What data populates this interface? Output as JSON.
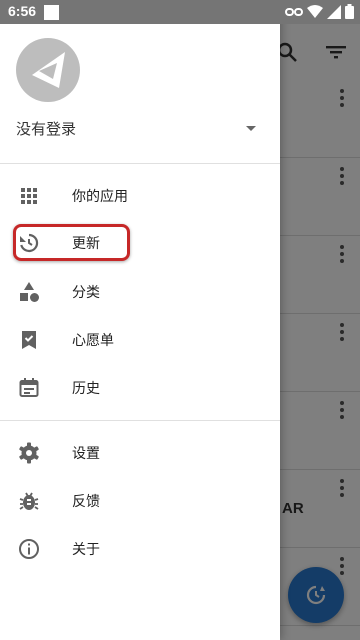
{
  "status_bar": {
    "time": "6:56"
  },
  "account": {
    "name": "没有登录"
  },
  "menu": {
    "items": [
      {
        "label": "你的应用",
        "icon": "apps-grid-icon"
      },
      {
        "label": "更新",
        "icon": "update-icon"
      },
      {
        "label": "分类",
        "icon": "category-icon"
      },
      {
        "label": "心愿单",
        "icon": "wishlist-icon"
      },
      {
        "label": "历史",
        "icon": "history-icon"
      }
    ],
    "secondary_items": [
      {
        "label": "设置",
        "icon": "settings-gear-icon"
      },
      {
        "label": "反馈",
        "icon": "feedback-bug-icon"
      },
      {
        "label": "关于",
        "icon": "about-info-icon"
      }
    ]
  },
  "background": {
    "visible_text": "AR"
  },
  "colors": {
    "highlight": "#c62828",
    "fab": "#2979cf",
    "icon": "#616161"
  }
}
